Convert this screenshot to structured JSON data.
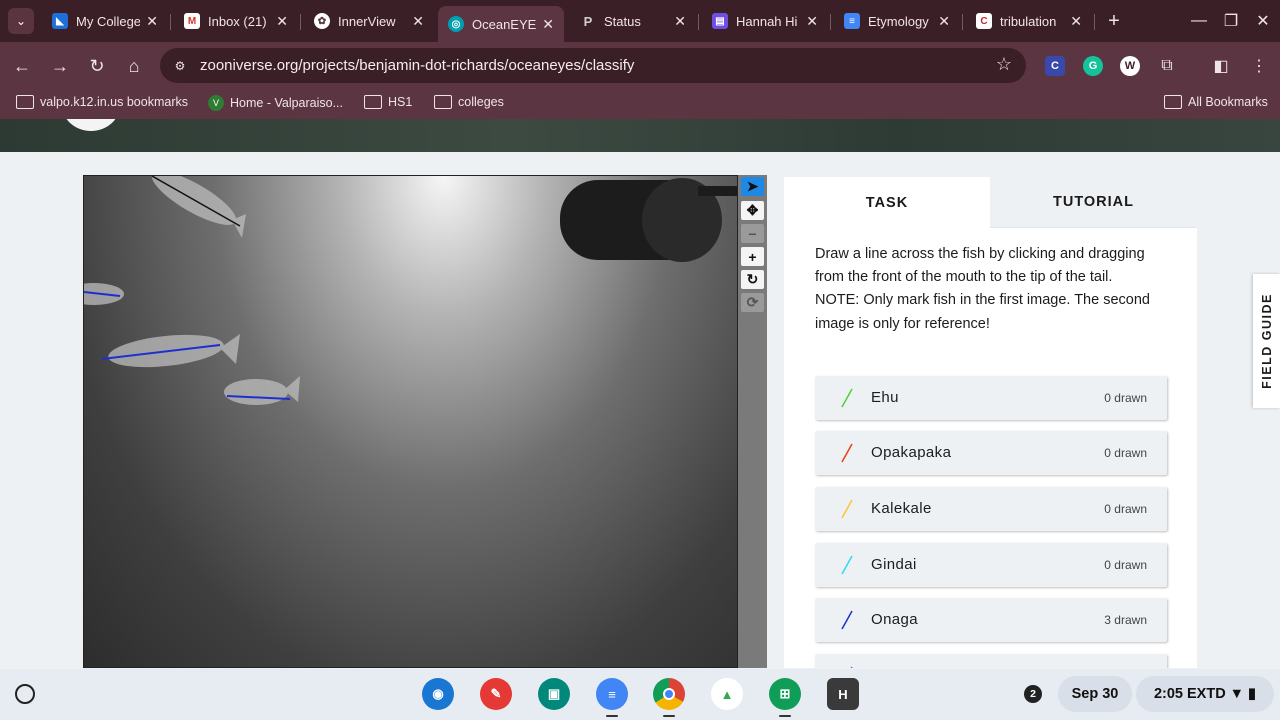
{
  "browser": {
    "tabs": [
      {
        "label": "My College",
        "icon": "app-icon",
        "color": "#1e6fd9",
        "glyph": ""
      },
      {
        "label": "Inbox (21)",
        "icon": "gmail-icon",
        "color": "#ffffff",
        "glyph": "M"
      },
      {
        "label": "InnerView",
        "icon": "innerview-icon",
        "color": "#ffffff",
        "glyph": ""
      },
      {
        "label": "OceanEYE",
        "icon": "zooniverse-icon",
        "color": "#00a0b0",
        "glyph": ""
      },
      {
        "label": "Status",
        "icon": "status-icon",
        "color": "#c0c0c0",
        "glyph": "P"
      },
      {
        "label": "Hannah Hi",
        "icon": "classroom-icon",
        "color": "#6f4de6",
        "glyph": ""
      },
      {
        "label": "Etymology",
        "icon": "docs-icon",
        "color": "#4285f4",
        "glyph": ""
      },
      {
        "label": "tribulation",
        "icon": "dictionary-icon",
        "color": "#c62828",
        "glyph": "C"
      }
    ],
    "active_tab_index": 3,
    "url": "zooniverse.org/projects/benjamin-dot-richards/oceaneyes/classify",
    "extensions": [
      {
        "name": "c-extension-icon",
        "letter": "C",
        "color": "#3949ab"
      },
      {
        "name": "grammarly-icon",
        "letter": "G",
        "color": "#15c39a"
      },
      {
        "name": "extension-w-icon",
        "letter": "W",
        "color": "#ffffff"
      }
    ],
    "bookmarks": [
      {
        "label": "valpo.k12.in.us bookmarks",
        "icon": "managed-folder-icon"
      },
      {
        "label": "Home - Valparaiso...",
        "icon": "site-icon"
      },
      {
        "label": "HS1",
        "icon": "folder-icon"
      },
      {
        "label": "colleges",
        "icon": "folder-icon"
      }
    ],
    "all_bookmarks": "All Bookmarks"
  },
  "classifier": {
    "tabs": {
      "task": "TASK",
      "tutorial": "TUTORIAL"
    },
    "instructions": [
      "Draw a line across the fish by clicking and dragging from the front of the mouth to the tip of the tail.",
      "NOTE: Only mark fish in the first image. The second image is only for reference!"
    ],
    "choices": [
      {
        "name": "Ehu",
        "count": "0 drawn",
        "color": "#4cd137"
      },
      {
        "name": "Opakapaka",
        "count": "0 drawn",
        "color": "#e84118"
      },
      {
        "name": "Kalekale",
        "count": "0 drawn",
        "color": "#fbc531"
      },
      {
        "name": "Gindai",
        "count": "0 drawn",
        "color": "#2fd8ef"
      },
      {
        "name": "Onaga",
        "count": "3 drawn",
        "color": "#1e2fd0"
      },
      {
        "name": "",
        "count": "",
        "color": "#c23ab0"
      }
    ],
    "tools": [
      "pointer-icon",
      "move-icon",
      "zoom-out-icon",
      "zoom-in-icon",
      "rotate-icon",
      "reset-icon"
    ],
    "field_guide": "FIELD GUIDE"
  },
  "shelf": {
    "apps": [
      {
        "name": "camera-app",
        "color": "#1976d2",
        "glyph": "◉"
      },
      {
        "name": "canvas-app",
        "color": "#e53935",
        "glyph": "✎"
      },
      {
        "name": "classroom-app",
        "color": "#00897b",
        "glyph": "▣"
      },
      {
        "name": "docs-app",
        "color": "#4285f4",
        "glyph": "≡"
      },
      {
        "name": "chrome-app",
        "color": "#db4437",
        "glyph": "●"
      },
      {
        "name": "drive-app",
        "color": "#34a853",
        "glyph": "▲"
      },
      {
        "name": "sheets-app",
        "color": "#0f9d58",
        "glyph": "⊞"
      },
      {
        "name": "h-app",
        "color": "#3a3a3a",
        "glyph": "H"
      }
    ],
    "notification_count": "2",
    "date": "Sep 30",
    "time": "2:05",
    "time_suffix": "EXTD"
  }
}
